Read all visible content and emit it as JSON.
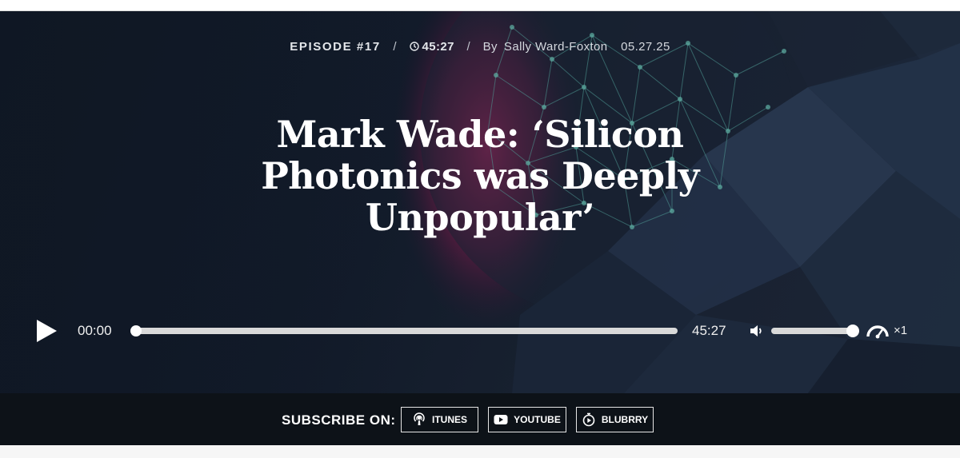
{
  "episode": {
    "label": "EPISODE #17",
    "duration": "45:27",
    "by_prefix": "By",
    "author": "Sally Ward-Foxton",
    "date": "05.27.25",
    "title": "Mark Wade: ‘Silicon Photonics was Deeply Unpopular’"
  },
  "player": {
    "current_time": "00:00",
    "total_time": "45:27",
    "progress_fraction": 0,
    "volume_fraction": 1,
    "speed": "×1"
  },
  "subscribe": {
    "label": "SUBSCRIBE ON:",
    "items": [
      {
        "label": "ITUNES",
        "icon": "podcast-icon"
      },
      {
        "label": "YOUTUBE",
        "icon": "youtube-icon"
      },
      {
        "label": "BLUBRRY",
        "icon": "blubrry-icon"
      }
    ]
  },
  "colors": {
    "hero_bg": "#121b2a",
    "subscribe_bg": "#0d1218",
    "accent_magenta": "#c21d5c",
    "network_teal": "#3f8f8a"
  }
}
